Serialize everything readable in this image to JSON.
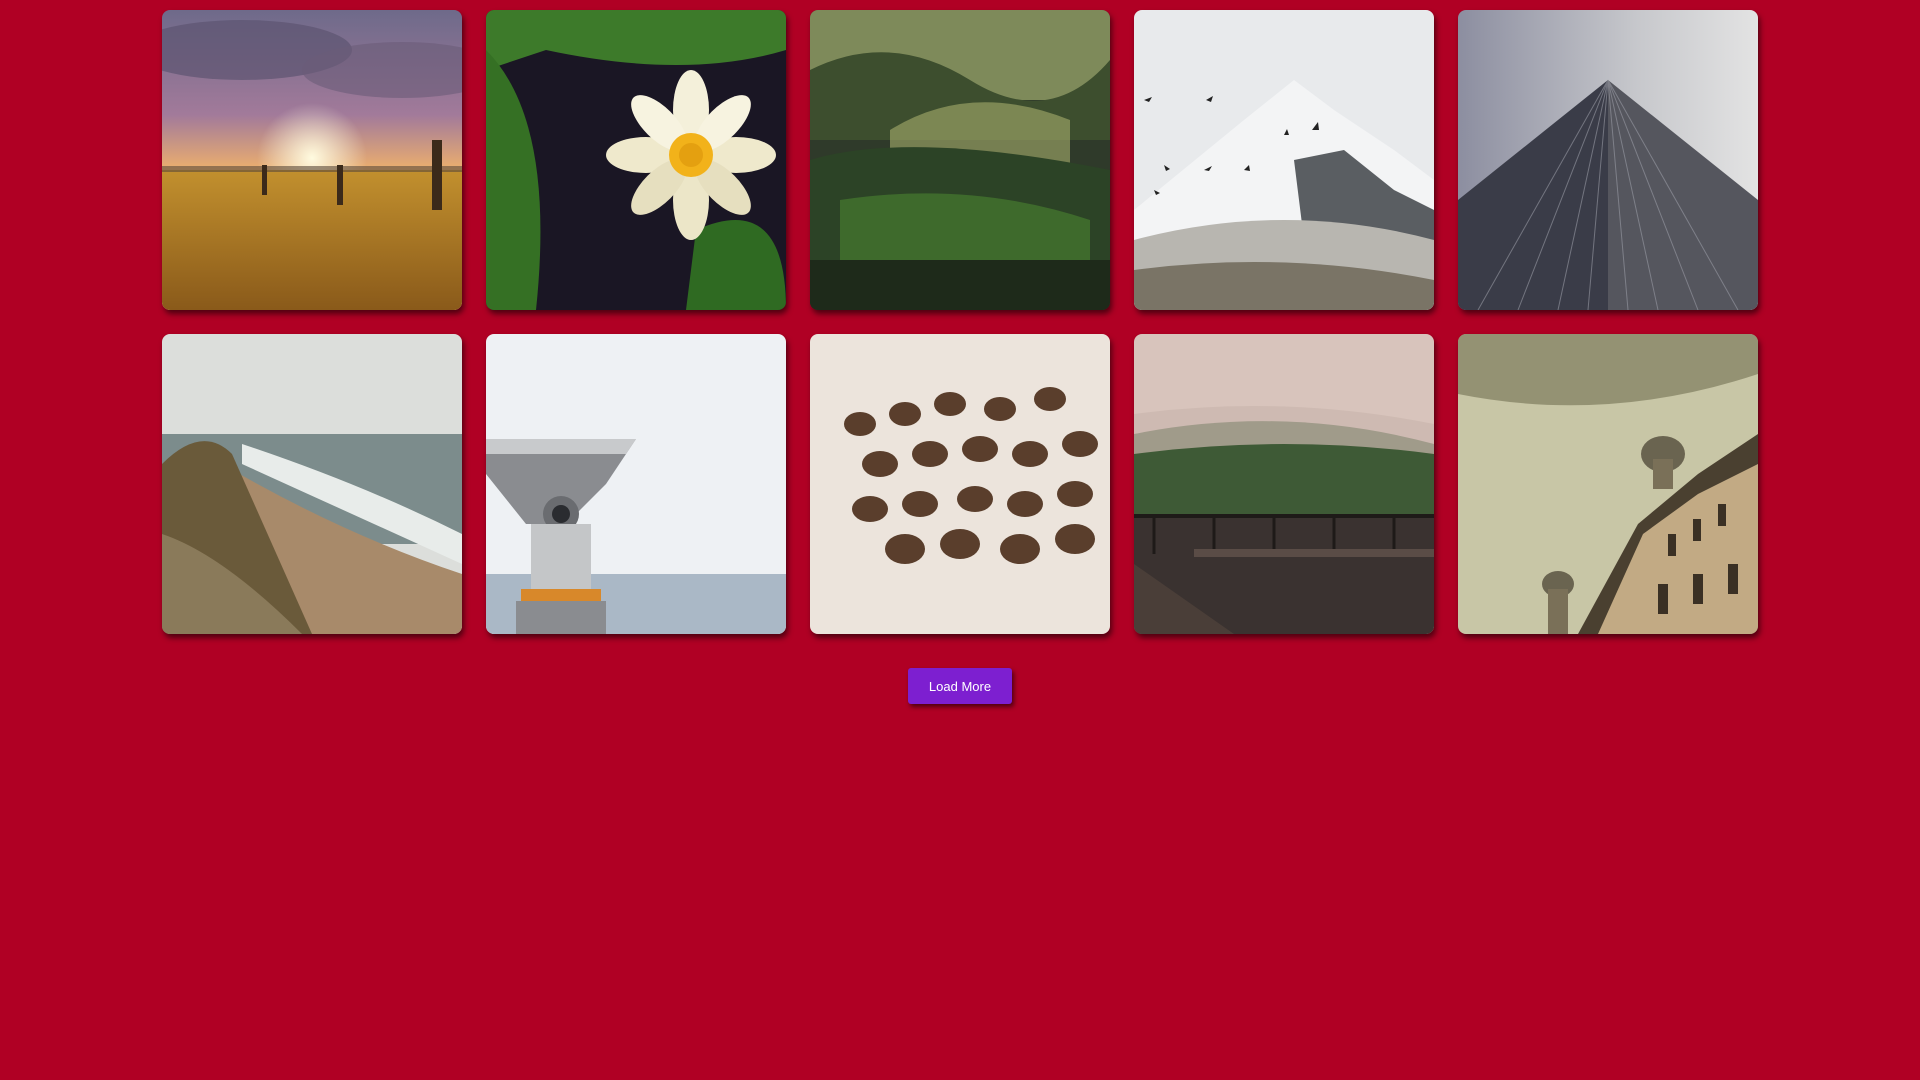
{
  "gallery": {
    "photos": [
      {
        "subject": "sunset-field"
      },
      {
        "subject": "water-lily"
      },
      {
        "subject": "misty-forest"
      },
      {
        "subject": "snowy-mountain"
      },
      {
        "subject": "glass-skyscraper"
      },
      {
        "subject": "coastal-cliff"
      },
      {
        "subject": "coin-binoculars"
      },
      {
        "subject": "coffee-beans"
      },
      {
        "subject": "foggy-balcony"
      },
      {
        "subject": "domed-building"
      }
    ]
  },
  "load_more": {
    "label": "Load More"
  },
  "colors": {
    "background": "#b00024",
    "button": "#7d1fd0",
    "button_text": "#ffffff"
  }
}
